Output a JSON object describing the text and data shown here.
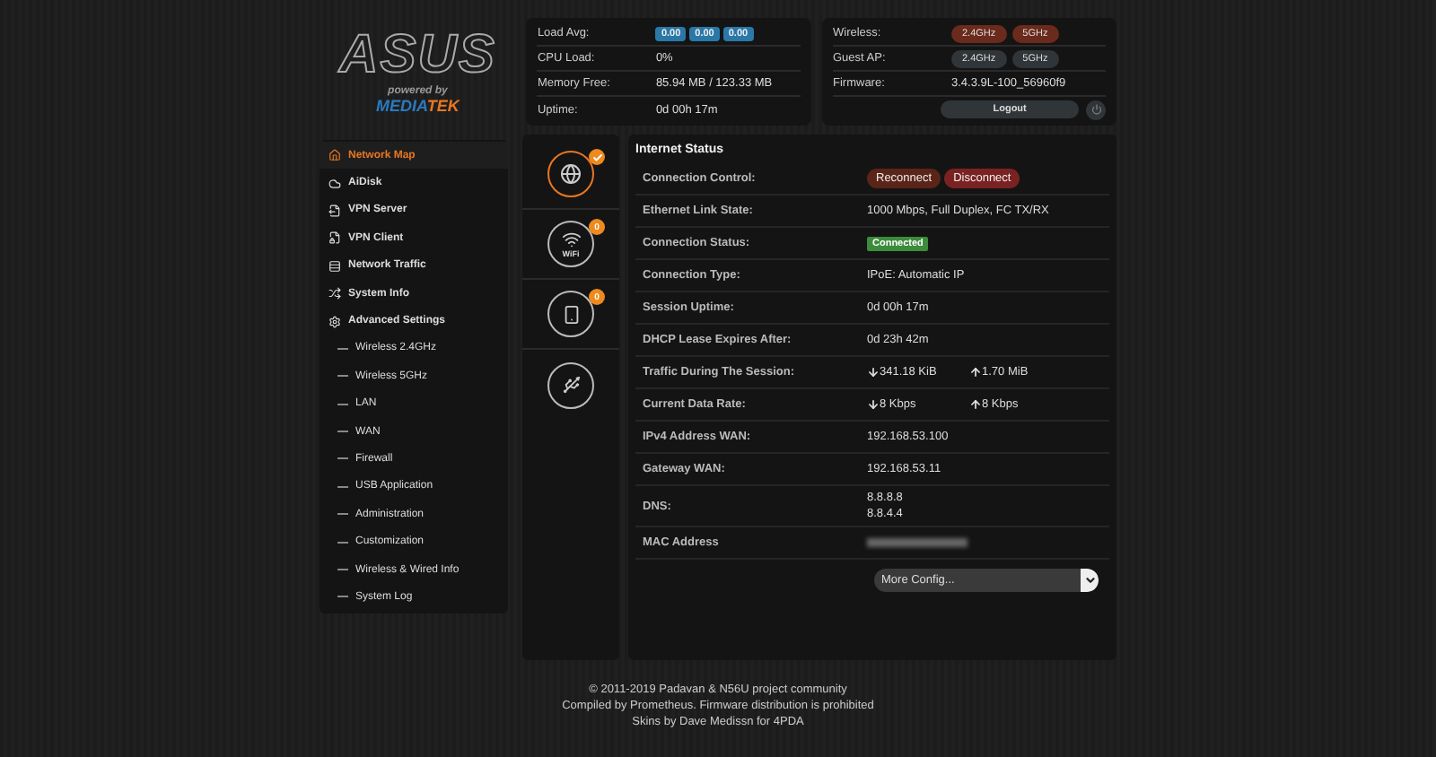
{
  "logo": {
    "brand": "ASUS",
    "powered": "powered by",
    "partner_left": "MEDIA",
    "partner_right": "TEK"
  },
  "system_status": [
    {
      "label": "Load Avg:",
      "kind": "badges",
      "values": [
        "0.00",
        "0.00",
        "0.00"
      ]
    },
    {
      "label": "CPU Load:",
      "kind": "text",
      "value": "0%"
    },
    {
      "label": "Memory Free:",
      "kind": "text",
      "value": "85.94 MB / 123.33 MB"
    },
    {
      "label": "Uptime:",
      "kind": "text",
      "value": "0d 00h 17m"
    }
  ],
  "radio_status": [
    {
      "label": "Wireless:",
      "kind": "chips",
      "chips": [
        {
          "label": "2.4GHz",
          "on": true
        },
        {
          "label": "5GHz",
          "on": true
        }
      ]
    },
    {
      "label": "Guest AP:",
      "kind": "chips",
      "chips": [
        {
          "label": "2.4GHz",
          "on": false
        },
        {
          "label": "5GHz",
          "on": false
        }
      ]
    },
    {
      "label": "Firmware:",
      "kind": "text",
      "value": "3.4.3.9L-100_56960f9"
    },
    {
      "kind": "logout",
      "value": "Logout"
    }
  ],
  "sidebar": {
    "items": [
      {
        "label": "Network Map",
        "kind": "main",
        "selected": true
      },
      {
        "label": "AiDisk",
        "kind": "main",
        "selected": false
      },
      {
        "label": "VPN Server",
        "kind": "main",
        "selected": false
      },
      {
        "label": "VPN Client",
        "kind": "main",
        "selected": false
      },
      {
        "label": "Network Traffic",
        "kind": "main",
        "selected": false
      },
      {
        "label": "System Info",
        "kind": "main",
        "selected": false
      },
      {
        "label": "Advanced Settings",
        "kind": "main",
        "selected": false
      },
      {
        "label": "Wireless 2.4GHz",
        "kind": "sub",
        "selected": false
      },
      {
        "label": "Wireless 5GHz",
        "kind": "sub",
        "selected": false
      },
      {
        "label": "LAN",
        "kind": "sub",
        "selected": false
      },
      {
        "label": "WAN",
        "kind": "sub",
        "selected": false
      },
      {
        "label": "Firewall",
        "kind": "sub",
        "selected": false
      },
      {
        "label": "USB Application",
        "kind": "sub",
        "selected": false
      },
      {
        "label": "Administration",
        "kind": "sub",
        "selected": false
      },
      {
        "label": "Customization",
        "kind": "sub",
        "selected": false
      },
      {
        "label": "Wireless & Wired Info",
        "kind": "sub",
        "selected": false
      },
      {
        "label": "System Log",
        "kind": "sub",
        "selected": false
      }
    ]
  },
  "map_tiles": [
    {
      "kind": "check",
      "selected": true
    },
    {
      "kind": "count",
      "selected": false,
      "badge": "0",
      "label": "WiFi"
    },
    {
      "kind": "count",
      "selected": false,
      "badge": "0"
    },
    {
      "kind": "plain",
      "selected": false
    }
  ],
  "internet_status": {
    "title": "Internet Status",
    "rows": [
      {
        "label": "Connection Control:",
        "kind": "buttons",
        "buttons": [
          "Reconnect",
          "Disconnect"
        ]
      },
      {
        "label": "Ethernet Link State:",
        "kind": "text",
        "value": "1000 Mbps, Full Duplex, FC TX/RX"
      },
      {
        "label": "Connection Status:",
        "kind": "badge",
        "value": "Connected"
      },
      {
        "label": "Connection Type:",
        "kind": "text",
        "value": "IPoE: Automatic IP"
      },
      {
        "label": "Session Uptime:",
        "kind": "text",
        "value": "0d 00h 17m"
      },
      {
        "label": "DHCP Lease Expires After:",
        "kind": "text",
        "value": "0d 23h 42m"
      },
      {
        "label": "Traffic During The Session:",
        "kind": "traffic",
        "down": "341.18 KiB",
        "up": "1.70 MiB"
      },
      {
        "label": "Current Data Rate:",
        "kind": "traffic",
        "down": "8 Kbps",
        "up": "8 Kbps"
      },
      {
        "label": "IPv4 Address WAN:",
        "kind": "text",
        "value": "192.168.53.100"
      },
      {
        "label": "Gateway WAN:",
        "kind": "text",
        "value": "192.168.53.11"
      },
      {
        "label": "DNS:",
        "kind": "lines",
        "lines": [
          "8.8.8.8",
          "8.8.4.4"
        ]
      },
      {
        "label": "MAC Address",
        "kind": "blurred"
      },
      {
        "kind": "select",
        "value": "More Config..."
      }
    ]
  },
  "footer": [
    "© 2011-2019 Padavan & N56U project community",
    "Compiled by Prometheus. Firmware distribution is prohibited",
    "Skins by Dave Medissn for 4PDA"
  ]
}
